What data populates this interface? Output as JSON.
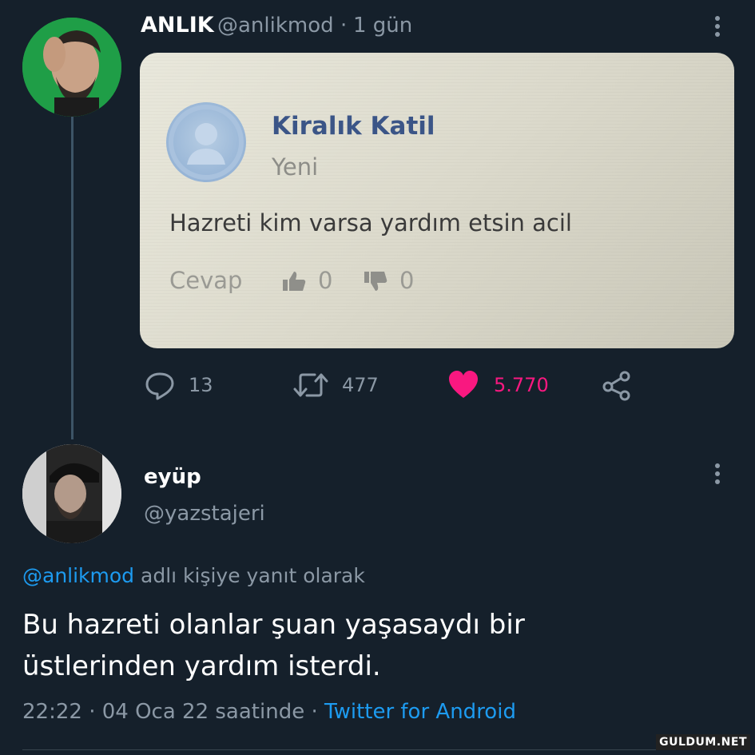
{
  "tweet1": {
    "name": "ANLIK",
    "handle": "@anlikmod",
    "separator": "·",
    "time": "1 gün",
    "photo": {
      "name": "Kiralık Katil",
      "subtitle": "Yeni",
      "text": "Hazreti kim varsa yardım etsin acil",
      "reply_label": "Cevap",
      "likes": "0",
      "dislikes": "0"
    },
    "actions": {
      "replies": "13",
      "retweets": "477",
      "likes": "5.770"
    }
  },
  "tweet2": {
    "name": "eyüp",
    "handle": "@yazstajeri",
    "reply_mention": "@anlikmod",
    "reply_suffix": " adlı kişiye yanıt olarak",
    "body_line1": "Bu hazreti olanlar şuan yaşasaydı bir",
    "body_line2": "üstlerinden yardım isterdi.",
    "time": "22:22",
    "sep1": " · ",
    "date": "04 Oca 22 saatinde",
    "sep2": " · ",
    "client": "Twitter for Android"
  },
  "watermark": "GULDUM.NET",
  "colors": {
    "background": "#15202b",
    "secondary_text": "#8b98a5",
    "accent": "#1d9bf0",
    "like": "#f91880"
  },
  "icons": {
    "more": "more-vertical-icon",
    "reply": "reply-bubble-icon",
    "retweet": "retweet-icon",
    "like": "heart-icon",
    "share": "share-icon"
  }
}
